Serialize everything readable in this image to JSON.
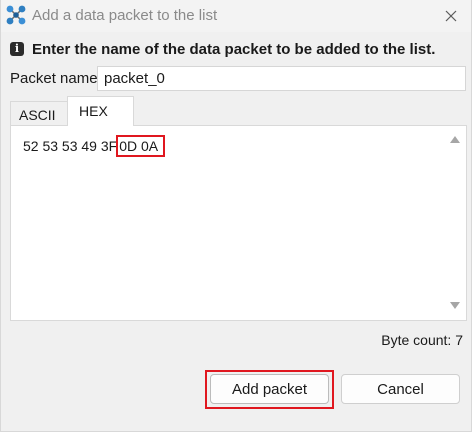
{
  "window": {
    "title": "Add a data packet to the list",
    "app_icon": "network-nodes-icon",
    "close_icon": "close-icon"
  },
  "instruction": {
    "icon": "info-icon",
    "icon_glyph": "i",
    "text": "Enter the name of the data packet to be added to the list."
  },
  "packet_name": {
    "label": "Packet name",
    "value": "packet_0"
  },
  "tabs": [
    {
      "label": "ASCII",
      "selected": false
    },
    {
      "label": "HEX",
      "selected": true
    }
  ],
  "editor": {
    "hex_prefix": "52 53 53 49 3F",
    "hex_highlighted": "0D 0A"
  },
  "byte_count": "Byte count: 7",
  "buttons": {
    "add": "Add packet",
    "cancel": "Cancel"
  },
  "colors": {
    "highlight": "#e0171f",
    "icon_blue": "#2f7fc1"
  }
}
